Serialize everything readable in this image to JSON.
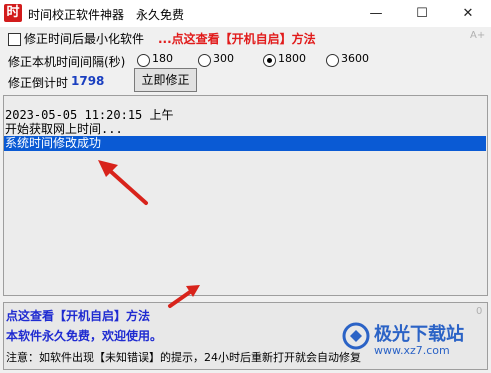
{
  "window": {
    "icon_glyph": "时",
    "title": "时间校正软件神器",
    "subtitle": "永久免费",
    "controls": [
      "—",
      "☐",
      "✕"
    ]
  },
  "options": {
    "minimize_label": "修正时间后最小化软件",
    "minimize_checked": false,
    "promo_link": "...点这查看【开机自启】方法",
    "corner_mark": "A+"
  },
  "interval": {
    "label": "修正本机时间间隔(秒)",
    "choices": [
      "180",
      "300",
      "1800",
      "3600"
    ],
    "selected": "1800"
  },
  "countdown": {
    "label": "修正倒计时",
    "value": "1798",
    "fix_button": "立即修正"
  },
  "log": {
    "lines": [
      "2023-05-05 11:20:15 上午",
      "开始获取网上时间..."
    ],
    "selected_line": "系统时间修改成功"
  },
  "bottom": {
    "link": "点这查看【开机自启】方法",
    "free_notice": "本软件永久免费，欢迎使用。",
    "note": "注意：如软件出现【未知错误】的提示，24小时后重新打开就会自动修复",
    "corner_mark": "0"
  },
  "watermark": {
    "name": "极光下载站",
    "url": "www.xz7.com"
  },
  "colors": {
    "promo_red": "#e11b1b",
    "link_blue": "#1f2bd1",
    "selection_blue": "#0a5ad4",
    "arrow_red": "#d8231b"
  }
}
